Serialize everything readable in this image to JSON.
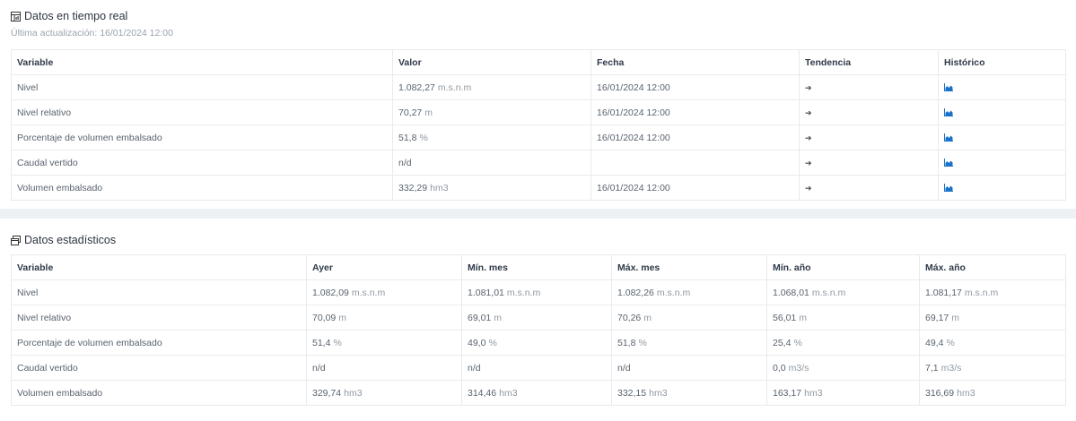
{
  "realtime": {
    "title": "Datos en tiempo real",
    "last_update": "Última actualización: 16/01/2024 12:00",
    "headers": [
      "Variable",
      "Valor",
      "Fecha",
      "Tendencia",
      "Histórico"
    ],
    "rows": [
      {
        "variable": "Nivel",
        "value": "1.082,27",
        "unit": "m.s.n.m",
        "date": "16/01/2024 12:00",
        "trend": "➔"
      },
      {
        "variable": "Nivel relativo",
        "value": "70,27",
        "unit": "m",
        "date": "16/01/2024 12:00",
        "trend": "➔"
      },
      {
        "variable": "Porcentaje de volumen embalsado",
        "value": "51,8",
        "unit": "%",
        "date": "16/01/2024 12:00",
        "trend": "➔"
      },
      {
        "variable": "Caudal vertido",
        "value": "n/d",
        "unit": "",
        "date": "",
        "trend": "➔"
      },
      {
        "variable": "Volumen embalsado",
        "value": "332,29",
        "unit": "hm3",
        "date": "16/01/2024 12:00",
        "trend": "➔"
      }
    ]
  },
  "stats": {
    "title": "Datos estadísticos",
    "headers": [
      "Variable",
      "Ayer",
      "Mín. mes",
      "Máx. mes",
      "Mín. año",
      "Máx. año"
    ],
    "rows": [
      {
        "variable": "Nivel",
        "cells": [
          {
            "value": "1.082,09",
            "unit": "m.s.n.m"
          },
          {
            "value": "1.081,01",
            "unit": "m.s.n.m"
          },
          {
            "value": "1.082,26",
            "unit": "m.s.n.m"
          },
          {
            "value": "1.068,01",
            "unit": "m.s.n.m"
          },
          {
            "value": "1.081,17",
            "unit": "m.s.n.m"
          }
        ]
      },
      {
        "variable": "Nivel relativo",
        "cells": [
          {
            "value": "70,09",
            "unit": "m"
          },
          {
            "value": "69,01",
            "unit": "m"
          },
          {
            "value": "70,26",
            "unit": "m"
          },
          {
            "value": "56,01",
            "unit": "m"
          },
          {
            "value": "69,17",
            "unit": "m"
          }
        ]
      },
      {
        "variable": "Porcentaje de volumen embalsado",
        "cells": [
          {
            "value": "51,4",
            "unit": "%"
          },
          {
            "value": "49,0",
            "unit": "%"
          },
          {
            "value": "51,8",
            "unit": "%"
          },
          {
            "value": "25,4",
            "unit": "%"
          },
          {
            "value": "49,4",
            "unit": "%"
          }
        ]
      },
      {
        "variable": "Caudal vertido",
        "cells": [
          {
            "value": "n/d",
            "unit": ""
          },
          {
            "value": "n/d",
            "unit": ""
          },
          {
            "value": "n/d",
            "unit": ""
          },
          {
            "value": "0,0",
            "unit": "m3/s"
          },
          {
            "value": "7,1",
            "unit": "m3/s"
          }
        ]
      },
      {
        "variable": "Volumen embalsado",
        "cells": [
          {
            "value": "329,74",
            "unit": "hm3"
          },
          {
            "value": "314,46",
            "unit": "hm3"
          },
          {
            "value": "332,15",
            "unit": "hm3"
          },
          {
            "value": "163,17",
            "unit": "hm3"
          },
          {
            "value": "316,69",
            "unit": "hm3"
          }
        ]
      }
    ]
  },
  "icons": {
    "realtime_title": "table-chart-icon",
    "stats_title": "stats-window-icon",
    "history": "area-chart-icon",
    "trend": "arrow-right-icon"
  },
  "colors": {
    "history_icon": "#1a73c9",
    "page_bg": "#eef1f4"
  }
}
